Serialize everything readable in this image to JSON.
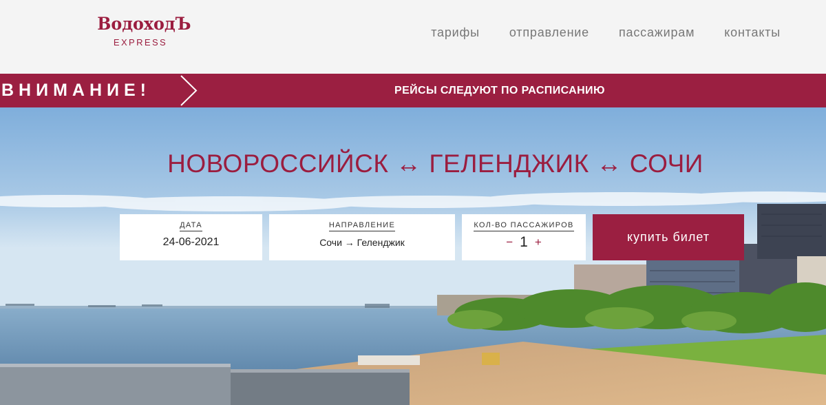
{
  "header": {
    "logo": {
      "main": "ВодоходЪ",
      "sub": "EXPRESS"
    },
    "nav": [
      {
        "label": "тарифы"
      },
      {
        "label": "отправление"
      },
      {
        "label": "пассажирам"
      },
      {
        "label": "контакты"
      }
    ]
  },
  "alert": {
    "label": "ВНИМАНИЕ!",
    "message": "РЕЙСЫ СЛЕДУЮТ ПО РАСПИСАНИЮ"
  },
  "hero": {
    "title": "НОВОРОССИЙСК ↔ ГЕЛЕНДЖИК ↔ СОЧИ"
  },
  "booking": {
    "date": {
      "label": "ДАТА",
      "value": "24-06-2021"
    },
    "direction": {
      "label": "НАПРАВЛЕНИЕ",
      "value": "Сочи → Геленджик"
    },
    "passengers": {
      "label": "КОЛ-ВО ПАССАЖИРОВ",
      "value": "1",
      "minus": "−",
      "plus": "+"
    },
    "buy_label": "купить билет"
  },
  "colors": {
    "brand": "#9b1f41",
    "header_bg": "#f4f4f4",
    "nav_text": "#777777"
  }
}
